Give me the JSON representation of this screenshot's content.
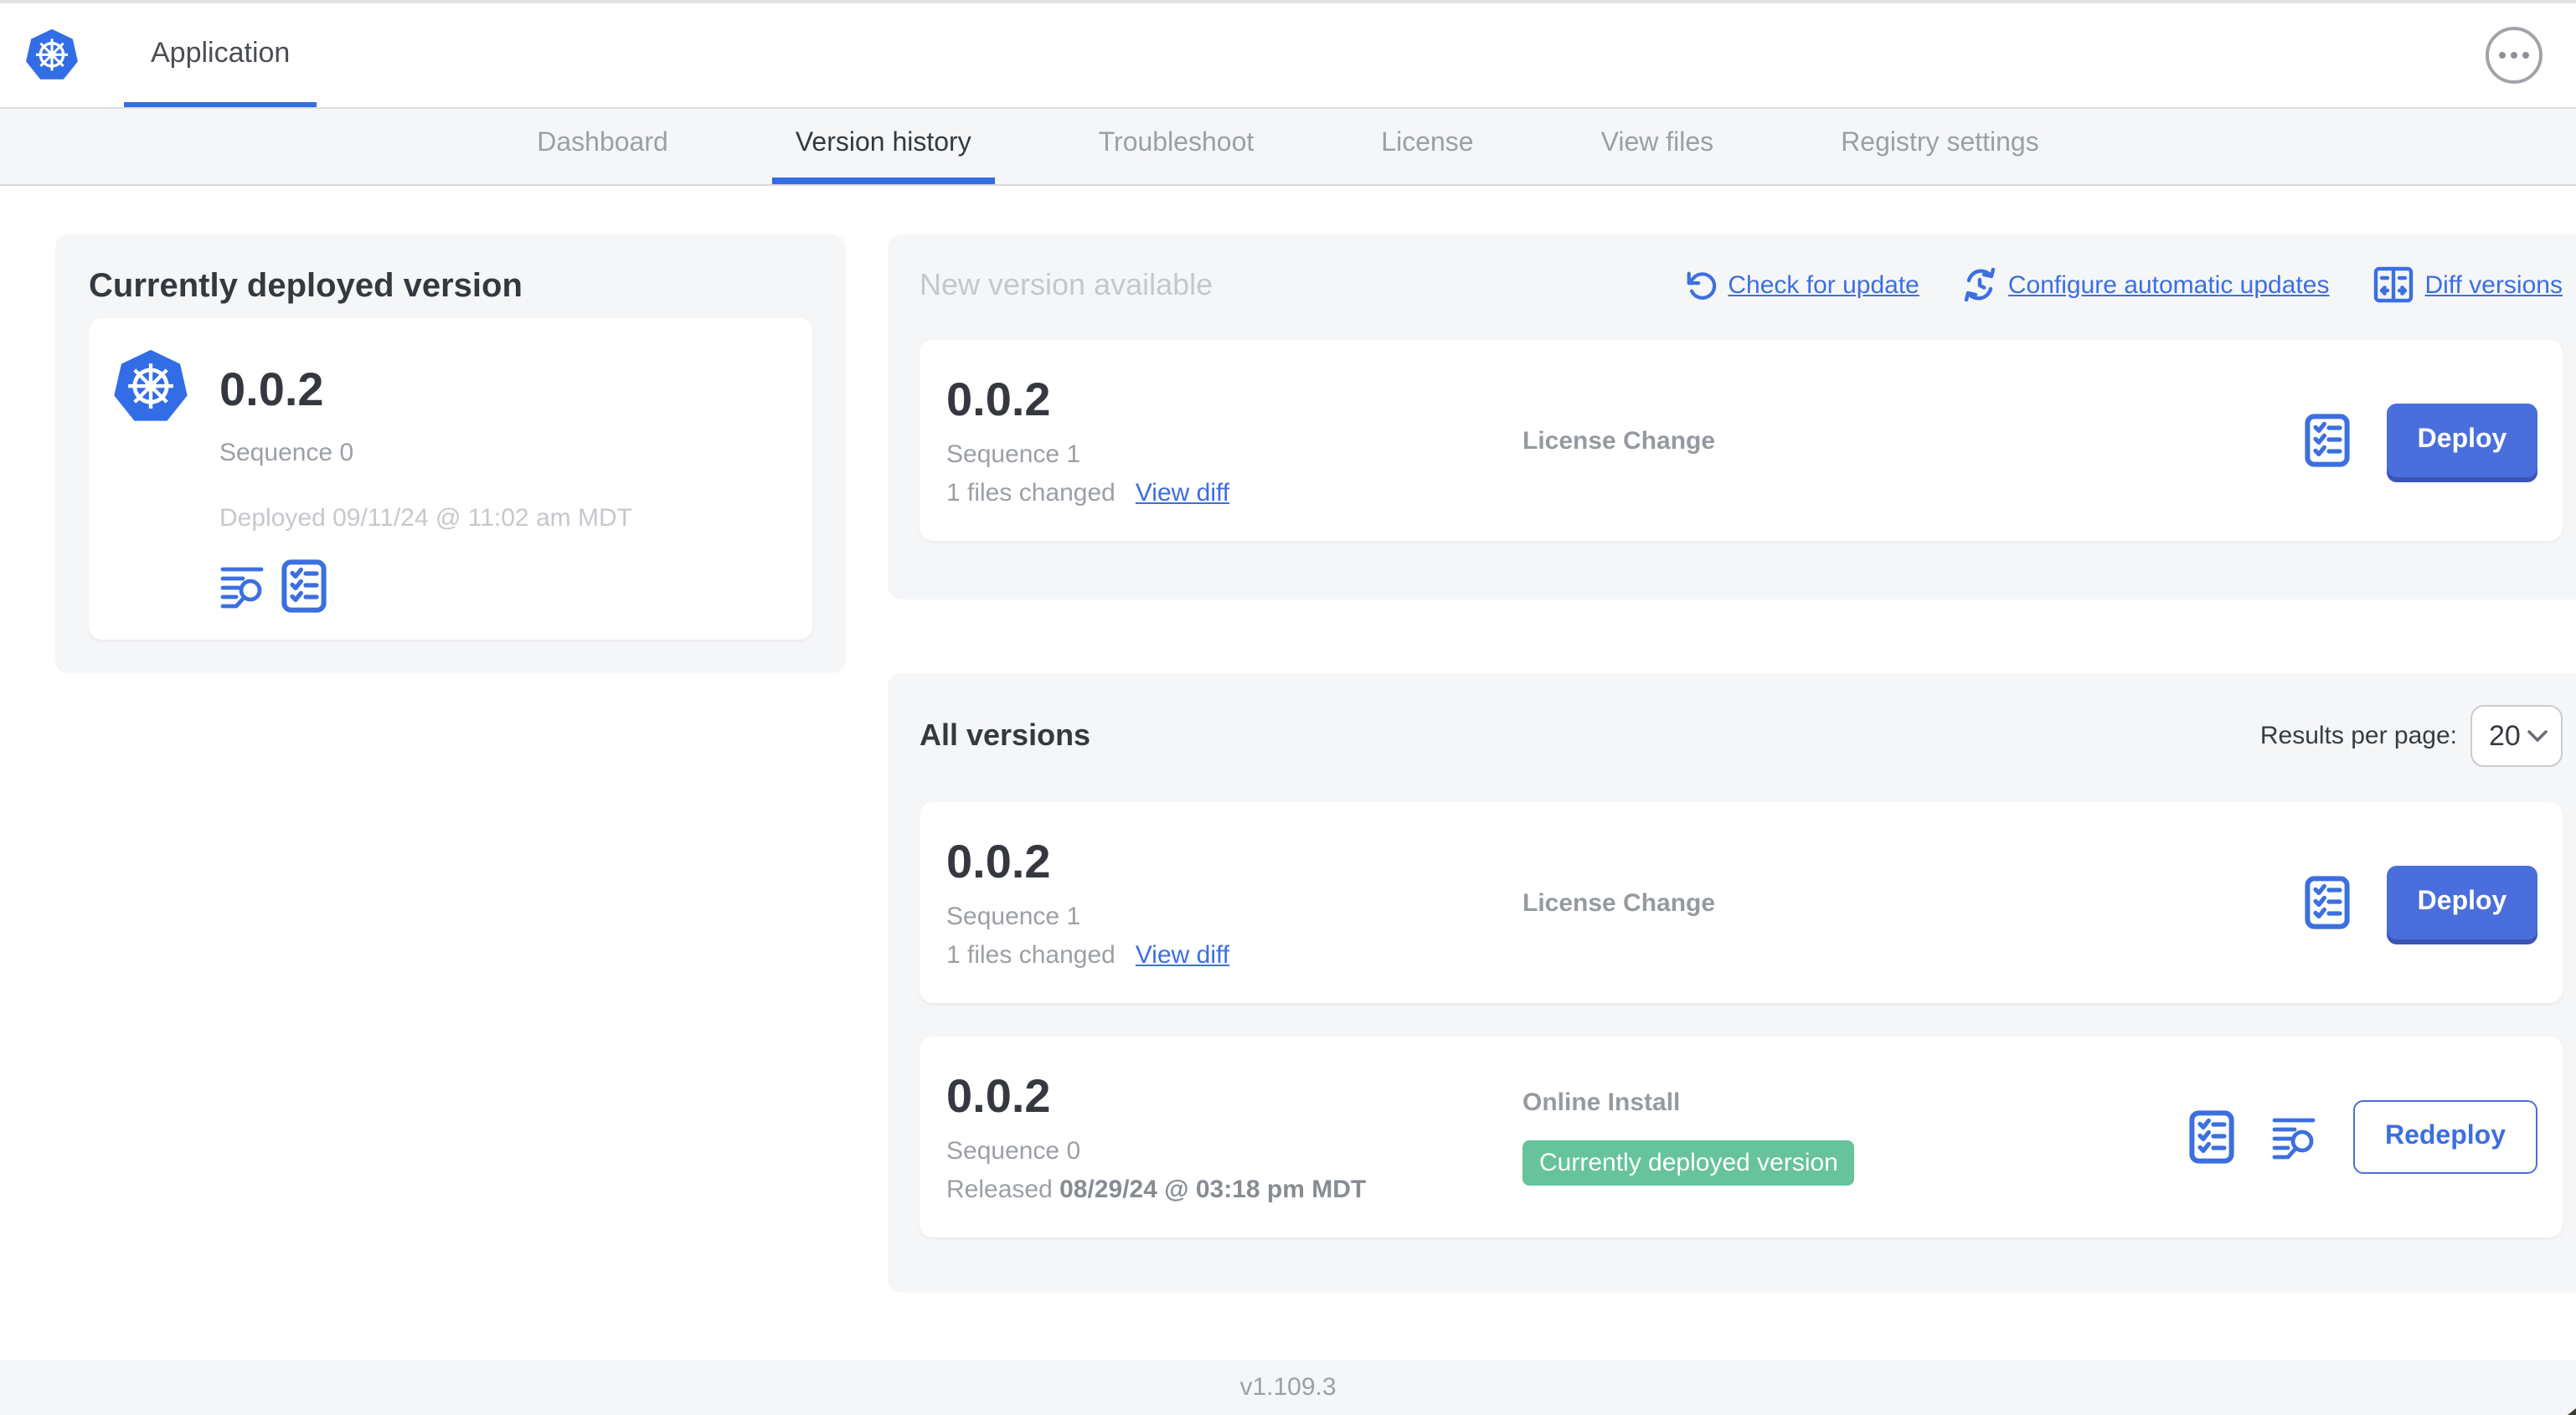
{
  "colors": {
    "accent_blue": "#326de6",
    "link_blue": "#3c6fdf",
    "button_blue": "#4a6edb",
    "badge_green": "#66c39c",
    "card_bg": "#f5f6f8"
  },
  "header": {
    "app_tab_label": "Application"
  },
  "nav": {
    "tabs": [
      {
        "label": "Dashboard",
        "active": false
      },
      {
        "label": "Version history",
        "active": true
      },
      {
        "label": "Troubleshoot",
        "active": false
      },
      {
        "label": "License",
        "active": false
      },
      {
        "label": "View files",
        "active": false
      },
      {
        "label": "Registry settings",
        "active": false
      }
    ]
  },
  "deployed_card": {
    "title": "Currently deployed version",
    "version": "0.0.2",
    "sequence": "Sequence 0",
    "deployed_at": "Deployed 09/11/24 @ 11:02 am MDT"
  },
  "new_version_section": {
    "title": "New version available",
    "actions": {
      "check_for_update": "Check for update",
      "configure_automatic_updates": "Configure automatic updates",
      "diff_versions": "Diff versions"
    },
    "row": {
      "version": "0.0.2",
      "sequence": "Sequence 1",
      "files_changed": "1 files changed",
      "view_diff_label": "View diff",
      "source": "License Change",
      "deploy_label": "Deploy"
    }
  },
  "all_versions_section": {
    "title": "All versions",
    "results_per_page_label": "Results per page:",
    "results_per_page_value": "20",
    "rows": [
      {
        "version": "0.0.2",
        "sequence": "Sequence 1",
        "files_changed": "1 files changed",
        "view_diff_label": "View diff",
        "source": "License Change",
        "action_label": "Deploy"
      },
      {
        "version": "0.0.2",
        "sequence": "Sequence 0",
        "released_prefix": "Released",
        "released_date": "08/29/24 @ 03:18 pm MDT",
        "source": "Online Install",
        "badge": "Currently deployed version",
        "action_label": "Redeploy"
      }
    ]
  },
  "footer": {
    "version": "v1.109.3"
  }
}
